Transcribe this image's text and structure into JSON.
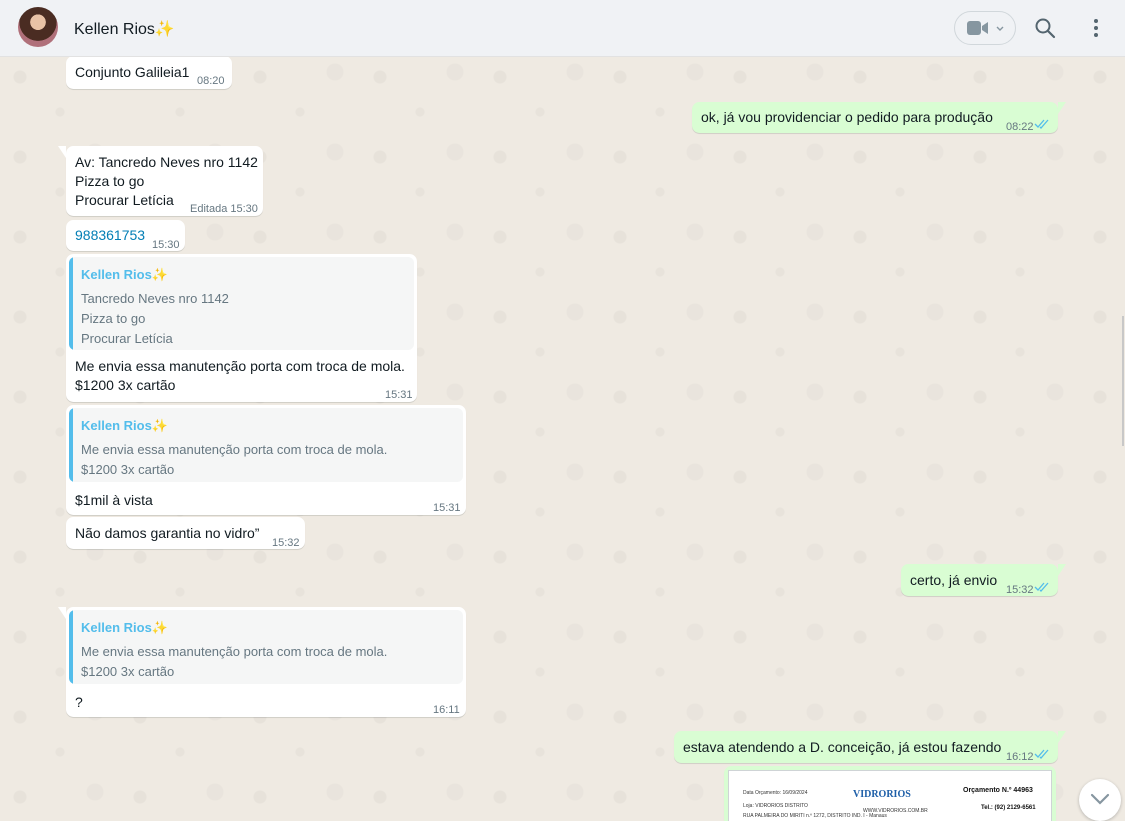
{
  "header": {
    "contact_name": "Kellen Rios✨"
  },
  "messages": {
    "m1": {
      "text": "Conjunto Galileia1",
      "time": "08:20"
    },
    "m2": {
      "text": "ok, já vou providenciar o pedido para produção",
      "time": "08:22"
    },
    "m3": {
      "lines": [
        "Av: Tancredo Neves nro 1142",
        "Pizza to go",
        "Procurar Letícia"
      ],
      "time": "Editada 15:30"
    },
    "m4": {
      "text": "988361753",
      "time": "15:30"
    },
    "m5": {
      "quote_name": "Kellen Rios✨",
      "quote_lines": [
        "Tancredo Neves nro 1142",
        "Pizza to go",
        "Procurar Letícia"
      ],
      "lines": [
        "Me envia essa manutenção porta com troca de mola.",
        "$1200 3x cartão"
      ],
      "time": "15:31"
    },
    "m6": {
      "quote_name": "Kellen Rios✨",
      "quote_lines": [
        "Me envia essa manutenção porta com troca de mola.",
        "$1200 3x cartão"
      ],
      "text": "$1mil à vista",
      "time": "15:31"
    },
    "m7": {
      "text": "Não damos garantia no vidro”",
      "time": "15:32"
    },
    "m8": {
      "text": "certo, já envio",
      "time": "15:32"
    },
    "m9": {
      "quote_name": "Kellen Rios✨",
      "quote_lines": [
        "Me envia essa manutenção porta com troca de mola.",
        "$1200 3x cartão"
      ],
      "text": "?",
      "time": "16:11"
    },
    "m10": {
      "text": "estava atendendo a D. conceição, já estou fazendo",
      "time": "16:12"
    }
  },
  "document": {
    "date_line": "Data Orçamento: 16/09/2024",
    "store_line": "Loja: VIDRORIOS DISTRITO",
    "address_line": "RUA PALMEIRA DO MIRITI n.º 1272, DISTRITO IND. I - Manaus",
    "logo": "VIDRORIOS",
    "website": "WWW.VIDRORIOS.COM.BR",
    "quote_number": "Orçamento N.º 44963",
    "phone": "Tel.: (92) 2129-6561"
  },
  "colors": {
    "incoming_bubble": "#ffffff",
    "outgoing_bubble": "#d9fdd3",
    "read_ticks": "#53bdeb",
    "quote_accent": "#53bdeb",
    "chat_background": "#efeae2"
  },
  "icons": [
    "video-call-icon",
    "chevron-down-icon",
    "search-icon",
    "menu-icon",
    "double-check-icon",
    "scroll-down-icon"
  ]
}
